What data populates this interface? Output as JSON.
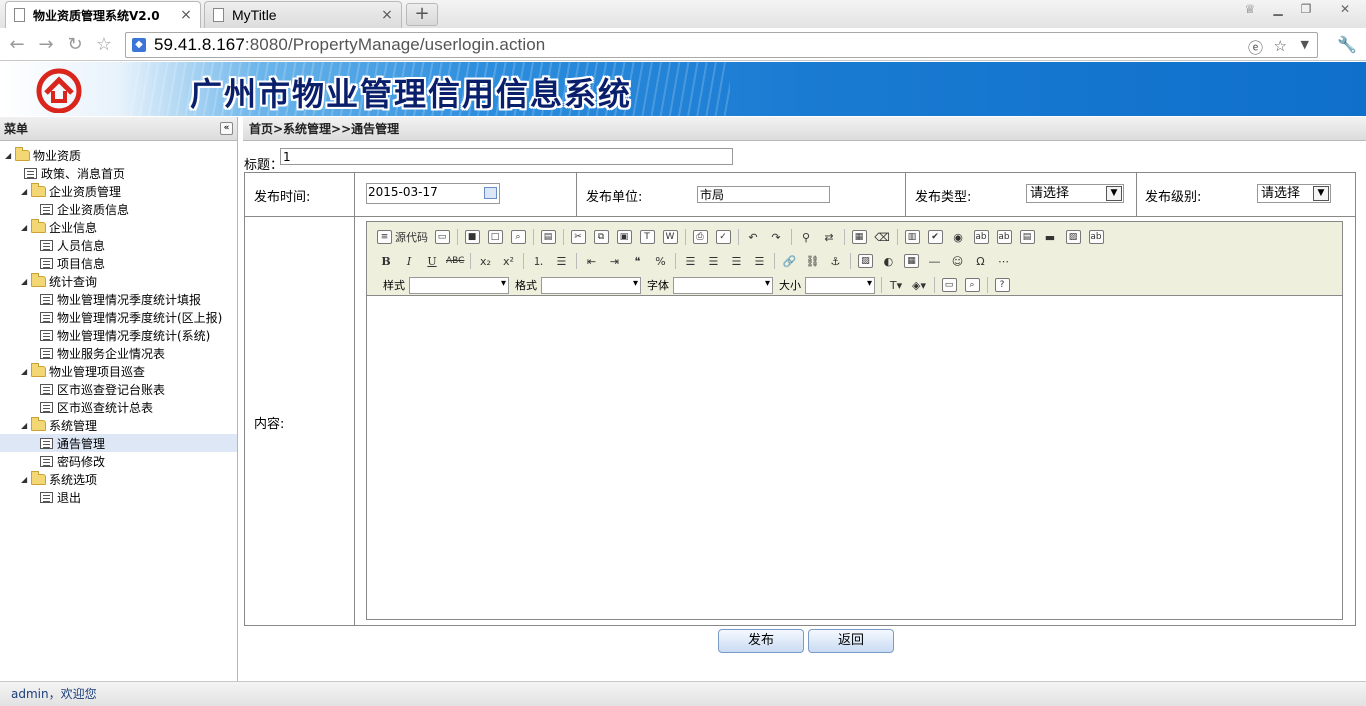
{
  "browser": {
    "tabs": [
      {
        "title": "物业资质管理系统V2.0",
        "active": true
      },
      {
        "title": "MyTitle",
        "active": false
      }
    ],
    "new_tab": "+",
    "close_glyph": "×",
    "url_host": "59.41.8.167",
    "url_rest": ":8080/PropertyManage/userlogin.action"
  },
  "banner": {
    "title": "广州市物业管理信用信息系统"
  },
  "sidebar": {
    "header": "菜单",
    "collapse": "«",
    "tree": [
      {
        "label": "物业资质",
        "type": "folder",
        "level": 0
      },
      {
        "label": "政策、消息首页",
        "type": "leaf",
        "level": 1
      },
      {
        "label": "企业资质管理",
        "type": "folder",
        "level": 1
      },
      {
        "label": "企业资质信息",
        "type": "leaf",
        "level": 2
      },
      {
        "label": "企业信息",
        "type": "folder",
        "level": 1
      },
      {
        "label": "人员信息",
        "type": "leaf",
        "level": 2
      },
      {
        "label": "项目信息",
        "type": "leaf",
        "level": 2
      },
      {
        "label": "统计查询",
        "type": "folder",
        "level": 1
      },
      {
        "label": "物业管理情况季度统计填报",
        "type": "leaf",
        "level": 2
      },
      {
        "label": "物业管理情况季度统计(区上报)",
        "type": "leaf",
        "level": 2
      },
      {
        "label": "物业管理情况季度统计(系统)",
        "type": "leaf",
        "level": 2
      },
      {
        "label": "物业服务企业情况表",
        "type": "leaf",
        "level": 2
      },
      {
        "label": "物业管理项目巡查",
        "type": "folder",
        "level": 1
      },
      {
        "label": "区市巡查登记台账表",
        "type": "leaf",
        "level": 2
      },
      {
        "label": "区市巡查统计总表",
        "type": "leaf",
        "level": 2
      },
      {
        "label": "系统管理",
        "type": "folder",
        "level": 1
      },
      {
        "label": "通告管理",
        "type": "leaf",
        "level": 2,
        "selected": true
      },
      {
        "label": "密码修改",
        "type": "leaf",
        "level": 2
      },
      {
        "label": "系统选项",
        "type": "folder",
        "level": 1
      },
      {
        "label": "退出",
        "type": "leaf",
        "level": 2
      }
    ]
  },
  "content": {
    "breadcrumb": "首页>系统管理>>通告管理",
    "title_label": "标题：",
    "title_value": "1",
    "publish_time_label": "发布时间:",
    "publish_time_value": "2015-03-17",
    "publish_unit_label": "发布单位:",
    "publish_unit_value": "市局",
    "publish_type_label": "发布类型:",
    "publish_type_value": "请选择",
    "publish_level_label": "发布级别:",
    "publish_level_value": "请选择",
    "content_label": "内容:",
    "editor": {
      "source_label": "源代码",
      "style_label": "样式",
      "format_label": "格式",
      "font_label": "字体",
      "size_label": "大小"
    },
    "submit_label": "发布",
    "back_label": "返回"
  },
  "status": {
    "text": "admin，欢迎您"
  }
}
